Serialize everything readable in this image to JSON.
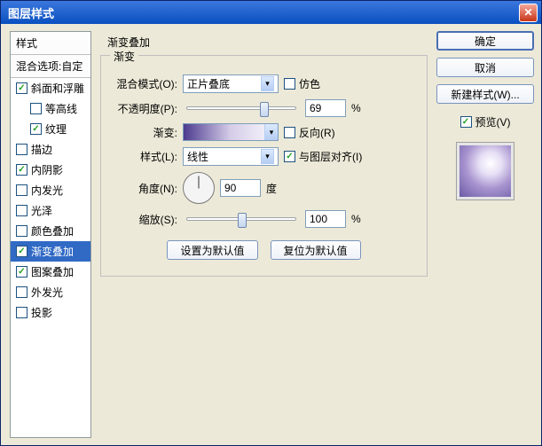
{
  "window": {
    "title": "图层样式"
  },
  "sidebar": {
    "styles_tab": "样式",
    "blend_options": "混合选项:自定",
    "items": [
      {
        "label": "斜面和浮雕",
        "checked": true,
        "indent": false
      },
      {
        "label": "等高线",
        "checked": false,
        "indent": true
      },
      {
        "label": "纹理",
        "checked": true,
        "indent": true
      },
      {
        "label": "描边",
        "checked": false,
        "indent": false
      },
      {
        "label": "内阴影",
        "checked": true,
        "indent": false
      },
      {
        "label": "内发光",
        "checked": false,
        "indent": false
      },
      {
        "label": "光泽",
        "checked": false,
        "indent": false
      },
      {
        "label": "颜色叠加",
        "checked": false,
        "indent": false
      },
      {
        "label": "渐变叠加",
        "checked": true,
        "indent": false,
        "selected": true
      },
      {
        "label": "图案叠加",
        "checked": true,
        "indent": false
      },
      {
        "label": "外发光",
        "checked": false,
        "indent": false
      },
      {
        "label": "投影",
        "checked": false,
        "indent": false
      }
    ]
  },
  "main": {
    "section_title": "渐变叠加",
    "group_title": "渐变",
    "blend_mode_label": "混合模式(O):",
    "blend_mode_value": "正片叠底",
    "dither_label": "仿色",
    "opacity_label": "不透明度(P):",
    "opacity_value": "69",
    "percent": "%",
    "gradient_label": "渐变:",
    "reverse_label": "反向(R)",
    "style_label": "样式(L):",
    "style_value": "线性",
    "align_label": "与图层对齐(I)",
    "angle_label": "角度(N):",
    "angle_value": "90",
    "angle_unit": "度",
    "scale_label": "缩放(S):",
    "scale_value": "100",
    "defaults_set": "设置为默认值",
    "defaults_reset": "复位为默认值"
  },
  "right": {
    "ok": "确定",
    "cancel": "取消",
    "new_style": "新建样式(W)...",
    "preview_label": "预览(V)"
  }
}
